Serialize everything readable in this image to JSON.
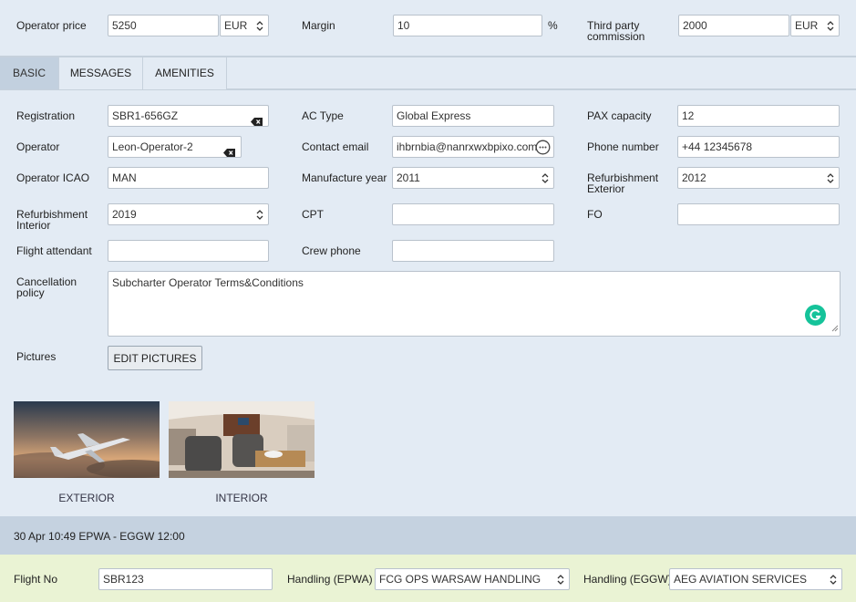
{
  "pricing": {
    "operator_price_label": "Operator price",
    "operator_price_value": "5250",
    "operator_currency": "EUR",
    "margin_label": "Margin",
    "margin_value": "10",
    "margin_unit": "%",
    "third_party_label_line1": "Third party",
    "third_party_label_line2": "commission",
    "third_party_value": "2000",
    "third_party_currency": "EUR"
  },
  "tabs": [
    {
      "label": "BASIC",
      "active": true
    },
    {
      "label": "MESSAGES",
      "active": false
    },
    {
      "label": "AMENITIES",
      "active": false
    }
  ],
  "form": {
    "registration_label": "Registration",
    "registration_value": "SBR1-656GZ",
    "ac_type_label": "AC Type",
    "ac_type_value": "Global Express",
    "pax_label": "PAX capacity",
    "pax_value": "12",
    "operator_label": "Operator",
    "operator_value": "Leon-Operator-2",
    "contact_email_label": "Contact email",
    "contact_email_value": "ihbrnbia@nanrxwxbpixo.com",
    "phone_label": "Phone number",
    "phone_value": "+44 12345678",
    "operator_icao_label": "Operator ICAO",
    "operator_icao_value": "MAN",
    "manufacture_year_label": "Manufacture year",
    "manufacture_year_value": "2011",
    "refurb_ext_label_line1": "Refurbishment",
    "refurb_ext_label_line2": "Exterior",
    "refurb_ext_value": "2012",
    "refurb_int_label_line1": "Refurbishment",
    "refurb_int_label_line2": "Interior",
    "refurb_int_value": "2019",
    "cpt_label": "CPT",
    "cpt_value": "",
    "fo_label": "FO",
    "fo_value": "",
    "flight_attendant_label": "Flight attendant",
    "flight_attendant_value": "",
    "crew_phone_label": "Crew phone",
    "crew_phone_value": "",
    "cancellation_label_line1": "Cancellation",
    "cancellation_label_line2": "policy",
    "cancellation_value": "Subcharter Operator Terms&Conditions",
    "pictures_label": "Pictures",
    "edit_pictures_label": "EDIT PICTURES"
  },
  "pictures": [
    {
      "label": "EXTERIOR",
      "icon": "jet-exterior-photo"
    },
    {
      "label": "INTERIOR",
      "icon": "cabin-interior-photo"
    }
  ],
  "flight": {
    "summary": "30 Apr 10:49 EPWA - EGGW 12:00",
    "flight_no_label": "Flight No",
    "flight_no_value": "SBR123",
    "handling_dep_label": "Handling (EPWA)",
    "handling_dep_value": "FCG OPS WARSAW HANDLING",
    "handling_arr_label": "Handling (EGGW)",
    "handling_arr_value": "AEG AVIATION SERVICES"
  },
  "colors": {
    "background": "#e3ebf4",
    "active_tab": "#c2d0df",
    "flight_bar": "#c5d2e0",
    "bottom_bar": "#eaf3d4",
    "grammarly": "#15c39a"
  }
}
